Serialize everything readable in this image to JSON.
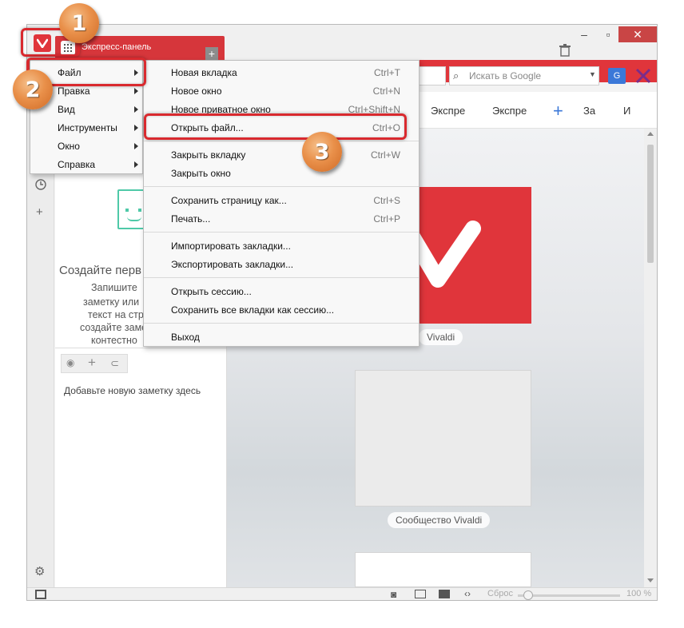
{
  "tab": {
    "title": "Экспресс-панель"
  },
  "search": {
    "placeholder": "Искать в Google"
  },
  "bookmarks": [
    "Экспре",
    "Экспре",
    "За",
    "И"
  ],
  "main_menu": [
    {
      "label": "Файл"
    },
    {
      "label": "Правка"
    },
    {
      "label": "Вид"
    },
    {
      "label": "Инструменты"
    },
    {
      "label": "Окно"
    },
    {
      "label": "Справка"
    }
  ],
  "file_menu": {
    "groups": [
      [
        {
          "label": "Новая вкладка",
          "shortcut": "Ctrl+T"
        },
        {
          "label": "Новое окно",
          "shortcut": "Ctrl+N"
        },
        {
          "label": "Новое приватное окно",
          "shortcut": "Ctrl+Shift+N"
        },
        {
          "label": "Открыть файл...",
          "shortcut": "Ctrl+O"
        }
      ],
      [
        {
          "label": "Закрыть вкладку",
          "shortcut": "Ctrl+W"
        },
        {
          "label": "Закрыть окно",
          "shortcut": ""
        }
      ],
      [
        {
          "label": "Сохранить страницу как...",
          "shortcut": "Ctrl+S"
        },
        {
          "label": "Печать...",
          "shortcut": "Ctrl+P"
        }
      ],
      [
        {
          "label": "Импортировать закладки...",
          "shortcut": ""
        },
        {
          "label": "Экспортировать закладки...",
          "shortcut": ""
        }
      ],
      [
        {
          "label": "Открыть сессию...",
          "shortcut": ""
        },
        {
          "label": "Сохранить все вкладки как сессию...",
          "shortcut": ""
        }
      ],
      [
        {
          "label": "Выход",
          "shortcut": ""
        }
      ]
    ]
  },
  "notes_panel": {
    "heading": "Создайте перв",
    "body_lines": [
      "Запишите",
      "заметку или",
      "текст на стр",
      "создайте заме",
      "контестно"
    ],
    "add_note": "Добавьте новую заметку здесь"
  },
  "speed_dial": {
    "tiles": [
      {
        "caption": "Vivaldi"
      },
      {
        "caption": "Сообщество Vivaldi"
      }
    ]
  },
  "status": {
    "reset": "Сброс",
    "zoom": "100 %",
    "zoom_level": 0.1
  },
  "annotations": [
    "1",
    "2",
    "3"
  ],
  "colors": {
    "brand": "#e0353b",
    "highlight": "#d9292e",
    "badge": "#e9904a"
  }
}
